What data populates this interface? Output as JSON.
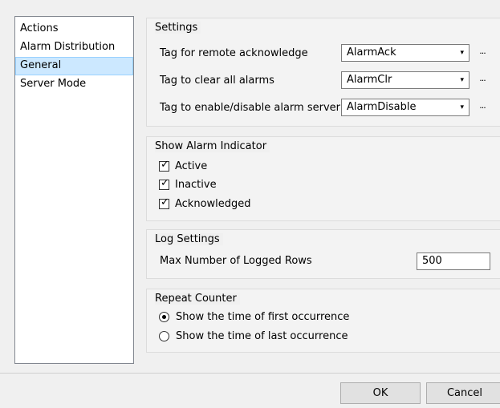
{
  "nav": {
    "items": [
      {
        "label": "Actions",
        "selected": false
      },
      {
        "label": "Alarm Distribution",
        "selected": false
      },
      {
        "label": "General",
        "selected": true
      },
      {
        "label": "Server Mode",
        "selected": false
      }
    ]
  },
  "settings": {
    "title": "Settings",
    "rows": [
      {
        "label": "Tag for remote acknowledge",
        "value": "AlarmAck"
      },
      {
        "label": "Tag to clear all alarms",
        "value": "AlarmClr"
      },
      {
        "label": "Tag to enable/disable alarm server",
        "value": "AlarmDisable"
      }
    ],
    "browse_label": "...",
    "dropdown_glyph": "▾"
  },
  "indicator": {
    "title": "Show Alarm Indicator",
    "options": [
      {
        "label": "Active",
        "checked": true
      },
      {
        "label": "Inactive",
        "checked": true
      },
      {
        "label": "Acknowledged",
        "checked": true
      }
    ]
  },
  "log": {
    "title": "Log Settings",
    "label": "Max Number of Logged Rows",
    "value": "500"
  },
  "repeat": {
    "title": "Repeat Counter",
    "options": [
      {
        "label": "Show the time of first occurrence",
        "selected": true
      },
      {
        "label": "Show the time of last occurrence",
        "selected": false
      }
    ]
  },
  "buttons": {
    "ok": "OK",
    "cancel": "Cancel"
  }
}
